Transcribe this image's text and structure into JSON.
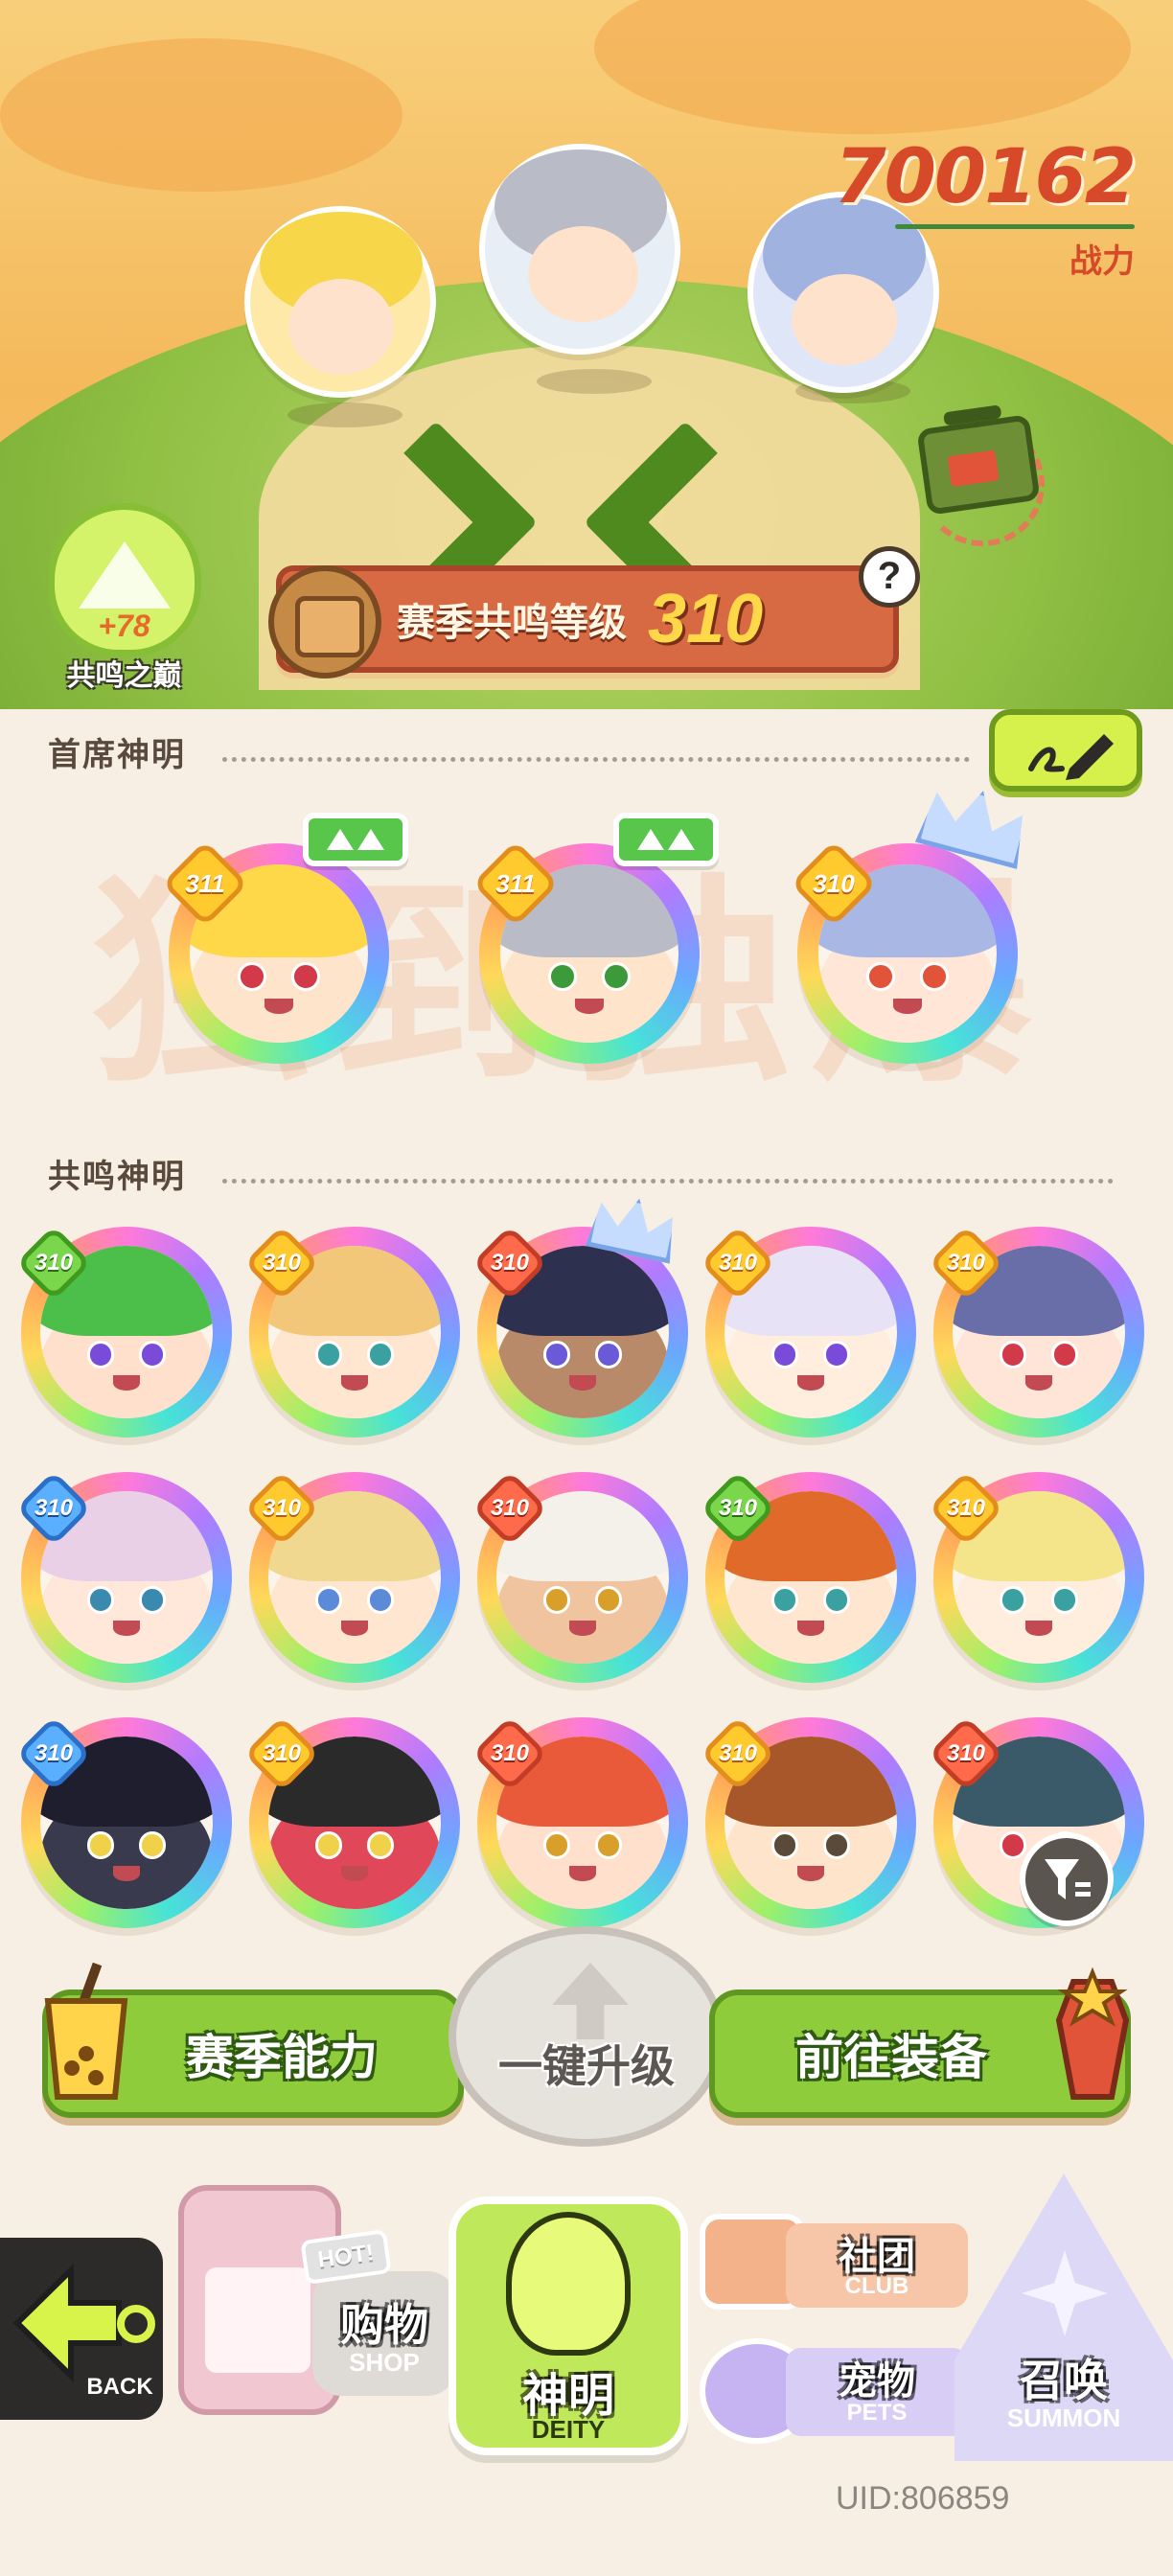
{
  "header": {
    "power_value": "700162",
    "power_label": "战力",
    "peak_plus": "+78",
    "peak_label": "共鸣之巅",
    "season_label": "赛季共鸣等级",
    "season_level": "310",
    "help_label": "?"
  },
  "sections": {
    "chief_title": "首席神明",
    "resonance_title": "共鸣神明"
  },
  "watermark": "独到独爆",
  "chief_deities": [
    {
      "level": "311",
      "upgradable": true
    },
    {
      "level": "311",
      "upgradable": true
    },
    {
      "level": "310",
      "upgradable": false,
      "crown": true
    }
  ],
  "resonance_deities": [
    {
      "level": "310"
    },
    {
      "level": "310"
    },
    {
      "level": "310"
    },
    {
      "level": "310"
    },
    {
      "level": "310"
    },
    {
      "level": "310"
    },
    {
      "level": "310"
    },
    {
      "level": "310"
    },
    {
      "level": "310"
    },
    {
      "level": "310"
    },
    {
      "level": "310"
    },
    {
      "level": "310"
    },
    {
      "level": "310"
    },
    {
      "level": "310"
    },
    {
      "level": "310"
    }
  ],
  "actions": {
    "season_ability": "赛季能力",
    "upgrade_all": "一键升级",
    "go_equip": "前往装备"
  },
  "nav": {
    "back_en": "BACK",
    "shop_cn": "购物",
    "shop_en": "SHOP",
    "shop_hot": "HOT!",
    "deity_cn": "神明",
    "deity_en": "DEITY",
    "club_cn": "社团",
    "club_en": "CLUB",
    "pets_cn": "宠物",
    "pets_en": "PETS",
    "summon_cn": "召唤",
    "summon_en": "SUMMON"
  },
  "footer": {
    "uid": "UID:806859"
  },
  "colors": {
    "accent_red": "#d64a2a",
    "accent_green": "#8fcc3c",
    "background": "#f7efe3"
  }
}
